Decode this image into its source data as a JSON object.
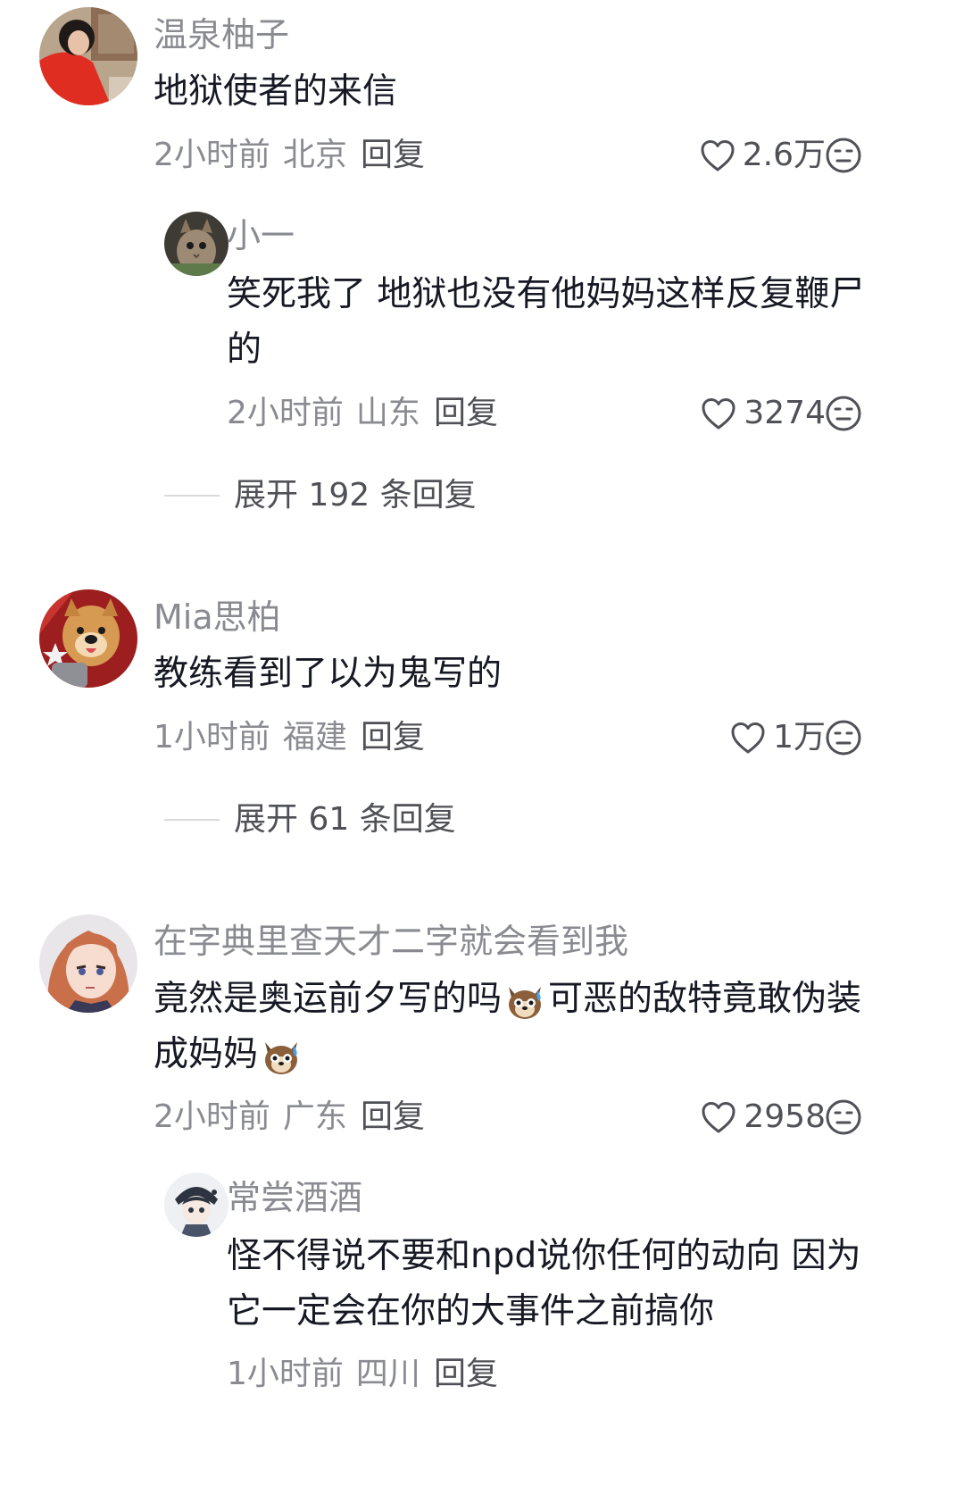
{
  "comments": [
    {
      "username": "温泉柚子",
      "text": "地狱使者的来信",
      "time": "2小时前",
      "location": "北京",
      "reply_label": "回复",
      "likes": "2.6万",
      "replies": [
        {
          "username": "小一",
          "text_line1": "笑死我了 地狱也没有他妈妈这样反复鞭尸",
          "text_line2": "的",
          "time": "2小时前",
          "location": "山东",
          "reply_label": "回复",
          "likes": "3274"
        }
      ],
      "expand_label": "展开 192 条回复"
    },
    {
      "username": "Mia思柏",
      "text": "教练看到了以为鬼写的",
      "time": "1小时前",
      "location": "福建",
      "reply_label": "回复",
      "likes": "1万",
      "expand_label": "展开 61 条回复"
    },
    {
      "username": "在字典里查天才二字就会看到我",
      "text_line1_a": "竟然是奥运前夕写的吗",
      "text_line1_b": "可恶的敌特竟敢伪装",
      "text_line2": "成妈妈",
      "time": "2小时前",
      "location": "广东",
      "reply_label": "回复",
      "likes": "2958",
      "replies": [
        {
          "username": "常尝酒酒",
          "text_line1": "怪不得说不要和npd说你任何的动向 因为",
          "text_line2": "它一定会在你的大事件之前搞你",
          "time": "1小时前",
          "location": "四川",
          "reply_label": "回复"
        }
      ]
    }
  ],
  "icons": {
    "like": "heart-outline-icon",
    "dislike": "neutral-face-icon",
    "inline_emoji": "sweating-dog-emoji"
  },
  "colors": {
    "text_primary": "#161823",
    "text_secondary": "#8a8b91",
    "text_action": "#505157"
  }
}
